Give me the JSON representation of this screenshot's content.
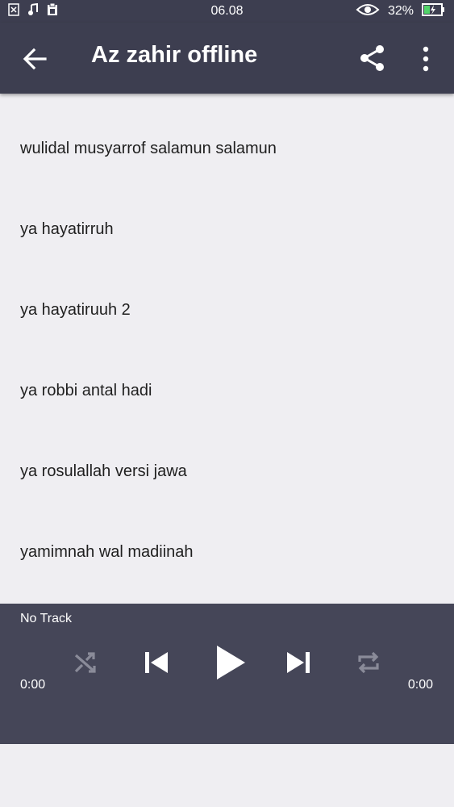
{
  "status_bar": {
    "time": "06.08",
    "battery": "32%"
  },
  "app_bar": {
    "title": "Az zahir offline"
  },
  "tracks": [
    "wulidal musyarrof salamun salamun",
    "ya hayatirruh",
    "ya hayatiruuh 2",
    "ya robbi antal hadi",
    "ya rosulallah versi jawa",
    "yamimnah wal madiinah"
  ],
  "player": {
    "track_name": "No Track",
    "elapsed": "0:00",
    "duration": "0:00"
  },
  "colors": {
    "header_bg": "#3d3e50",
    "player_bg": "#454658",
    "list_bg": "#efeef2",
    "battery_accent": "#52d46a"
  }
}
